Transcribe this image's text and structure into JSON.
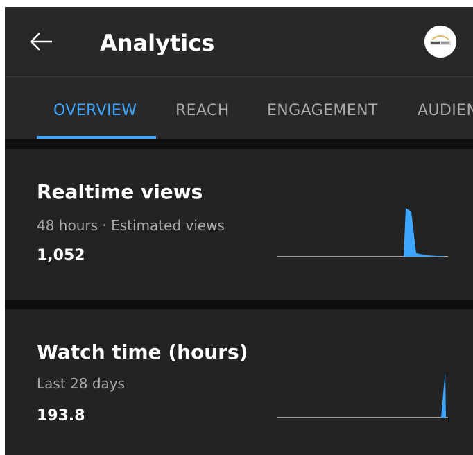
{
  "header": {
    "title": "Analytics",
    "back_icon": "arrow-left-icon",
    "avatar_icon": "channel-avatar-icon"
  },
  "tabs": [
    {
      "label": "OVERVIEW",
      "active": true
    },
    {
      "label": "REACH",
      "active": false
    },
    {
      "label": "ENGAGEMENT",
      "active": false
    },
    {
      "label": "AUDIENCE",
      "active": false
    }
  ],
  "cards": {
    "realtime": {
      "title": "Realtime views",
      "subtitle": "48 hours · Estimated views",
      "value": "1,052"
    },
    "watch_time": {
      "title": "Watch time (hours)",
      "subtitle": "Last 28 days",
      "value": "193.8"
    }
  },
  "colors": {
    "accent": "#3ea6ff",
    "spark_fill": "#3ea6ff",
    "background": "#212121"
  }
}
